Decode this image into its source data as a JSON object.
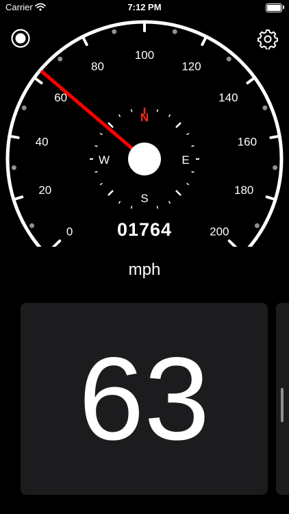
{
  "status_bar": {
    "carrier": "Carrier",
    "time": "7:12 PM",
    "wifi_icon": "wifi-icon",
    "battery_icon": "battery-icon",
    "battery_level": 1.0
  },
  "toolbar": {
    "record_icon": "record-icon",
    "settings_icon": "gear-icon"
  },
  "speedometer": {
    "min": 0,
    "max": 200,
    "major_step": 20,
    "needle_value": 63,
    "needle_color": "#ff0000",
    "tick_labels": [
      "0",
      "20",
      "40",
      "60",
      "80",
      "100",
      "120",
      "140",
      "160",
      "180",
      "200"
    ]
  },
  "compass": {
    "north": "N",
    "east": "E",
    "south": "S",
    "west": "W",
    "north_color": "#ff2a1a"
  },
  "odometer": {
    "value": "01764"
  },
  "unit": {
    "label": "mph"
  },
  "speed_card": {
    "value": "63"
  }
}
